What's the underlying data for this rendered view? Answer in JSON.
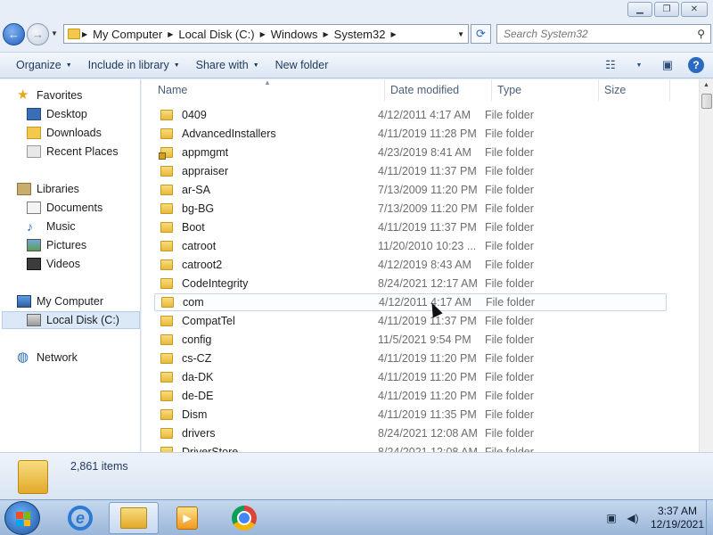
{
  "window": {
    "minimize": "▁",
    "maximize": "❐",
    "close": "✕"
  },
  "address": {
    "crumbs": [
      "My Computer",
      "Local Disk (C:)",
      "Windows",
      "System32"
    ]
  },
  "search": {
    "placeholder": "Search System32"
  },
  "toolbar": {
    "organize": "Organize",
    "include": "Include in library",
    "share": "Share with",
    "newfolder": "New folder"
  },
  "nav": {
    "favorites": "Favorites",
    "desktop": "Desktop",
    "downloads": "Downloads",
    "recent": "Recent Places",
    "libraries": "Libraries",
    "documents": "Documents",
    "music": "Music",
    "pictures": "Pictures",
    "videos": "Videos",
    "mycomputer": "My Computer",
    "localdisk": "Local Disk (C:)",
    "network": "Network"
  },
  "columns": {
    "name": "Name",
    "date": "Date modified",
    "type": "Type",
    "size": "Size"
  },
  "files": [
    {
      "name": "0409",
      "date": "4/12/2011 4:17 AM",
      "type": "File folder"
    },
    {
      "name": "AdvancedInstallers",
      "date": "4/11/2019 11:28 PM",
      "type": "File folder"
    },
    {
      "name": "appmgmt",
      "date": "4/23/2019 8:41 AM",
      "type": "File folder",
      "locked": true
    },
    {
      "name": "appraiser",
      "date": "4/11/2019 11:37 PM",
      "type": "File folder"
    },
    {
      "name": "ar-SA",
      "date": "7/13/2009 11:20 PM",
      "type": "File folder"
    },
    {
      "name": "bg-BG",
      "date": "7/13/2009 11:20 PM",
      "type": "File folder"
    },
    {
      "name": "Boot",
      "date": "4/11/2019 11:37 PM",
      "type": "File folder"
    },
    {
      "name": "catroot",
      "date": "11/20/2010 10:23 ...",
      "type": "File folder"
    },
    {
      "name": "catroot2",
      "date": "4/12/2019 8:43 AM",
      "type": "File folder"
    },
    {
      "name": "CodeIntegrity",
      "date": "8/24/2021 12:17 AM",
      "type": "File folder"
    },
    {
      "name": "com",
      "date": "4/12/2011 4:17 AM",
      "type": "File folder",
      "hover": true
    },
    {
      "name": "CompatTel",
      "date": "4/11/2019 11:37 PM",
      "type": "File folder"
    },
    {
      "name": "config",
      "date": "11/5/2021 9:54 PM",
      "type": "File folder"
    },
    {
      "name": "cs-CZ",
      "date": "4/11/2019 11:20 PM",
      "type": "File folder"
    },
    {
      "name": "da-DK",
      "date": "4/11/2019 11:20 PM",
      "type": "File folder"
    },
    {
      "name": "de-DE",
      "date": "4/11/2019 11:20 PM",
      "type": "File folder"
    },
    {
      "name": "Dism",
      "date": "4/11/2019 11:35 PM",
      "type": "File folder"
    },
    {
      "name": "drivers",
      "date": "8/24/2021 12:08 AM",
      "type": "File folder"
    },
    {
      "name": "DriverStore",
      "date": "8/24/2021 12:08 AM",
      "type": "File folder"
    }
  ],
  "details": {
    "count": "2,861 items"
  },
  "taskbar": {
    "time": "3:37 AM",
    "date": "12/19/2021",
    "apps": [
      "internet-explorer-icon",
      "windows-explorer-icon",
      "media-player-icon",
      "chrome-icon"
    ]
  },
  "colors": {
    "accent": "#2b6ac1",
    "folder": "#f2c94c",
    "selection": "#dbe8f8"
  }
}
